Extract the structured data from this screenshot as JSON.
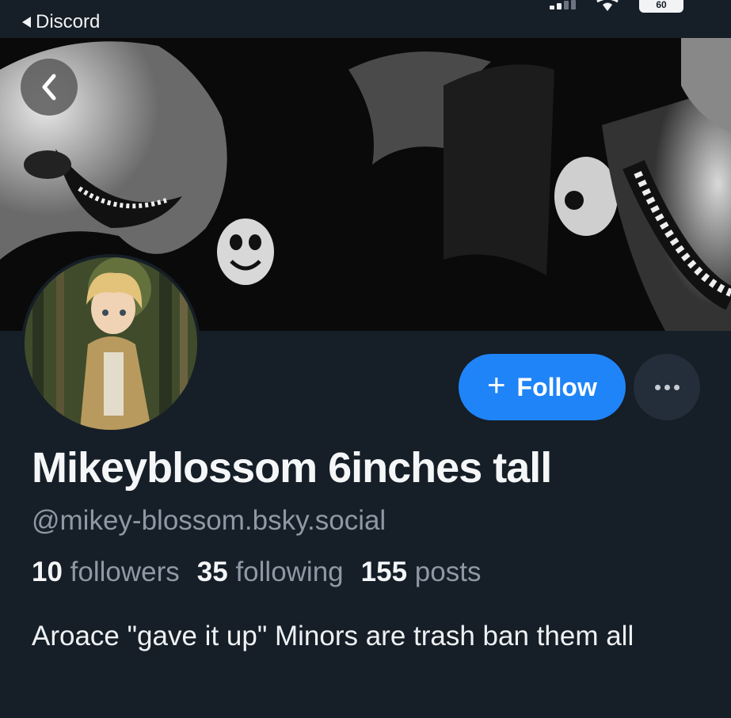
{
  "statusbar": {
    "back_app_label": "Discord",
    "battery_level": "60"
  },
  "profile": {
    "display_name": "Mikeyblossom 6inches tall",
    "handle": "@mikey-blossom.bsky.social",
    "bio": "Aroace \"gave it up\" Minors are trash ban them all",
    "stats": [
      {
        "count": "10",
        "label": "followers"
      },
      {
        "count": "35",
        "label": "following"
      },
      {
        "count": "155",
        "label": "posts"
      }
    ]
  },
  "actions": {
    "follow_label": "Follow",
    "follow_icon": "plus-icon",
    "more_icon": "ellipsis-icon"
  },
  "colors": {
    "background": "#161e27",
    "accent": "#1f84f7",
    "muted_text": "#8f99a5"
  }
}
